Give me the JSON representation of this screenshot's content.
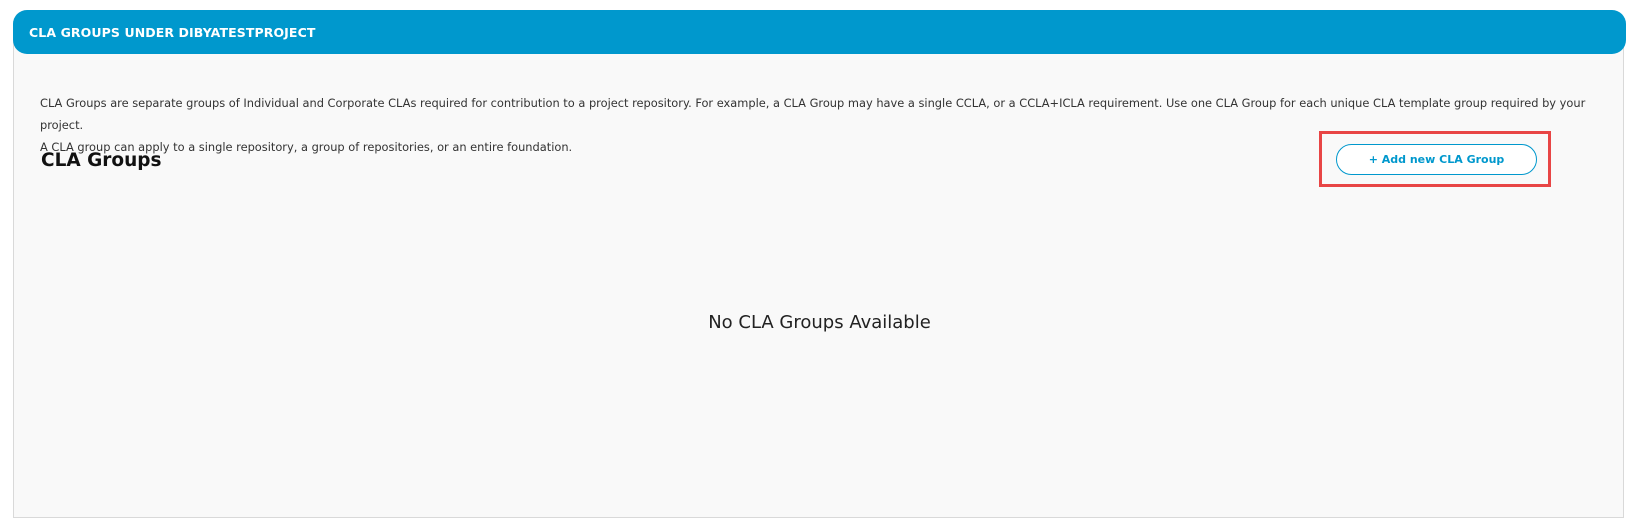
{
  "panel": {
    "title": "CLA GROUPS UNDER DIBYATESTPROJECT",
    "description_line1": "CLA Groups are separate groups of Individual and Corporate CLAs required for contribution to a project repository. For example, a CLA Group may have a single CCLA, or a CCLA+ICLA requirement. Use one CLA Group for each unique CLA template group required by your project.",
    "description_line2": "A CLA group can apply to a single repository, a group of repositories, or an entire foundation."
  },
  "section": {
    "title": "CLA Groups",
    "add_button_label": "+ Add new CLA Group",
    "empty_message": "No CLA Groups Available"
  },
  "colors": {
    "header_bg": "#0098cd",
    "highlight_border": "#e84545",
    "panel_bg": "#f9f9f9"
  }
}
